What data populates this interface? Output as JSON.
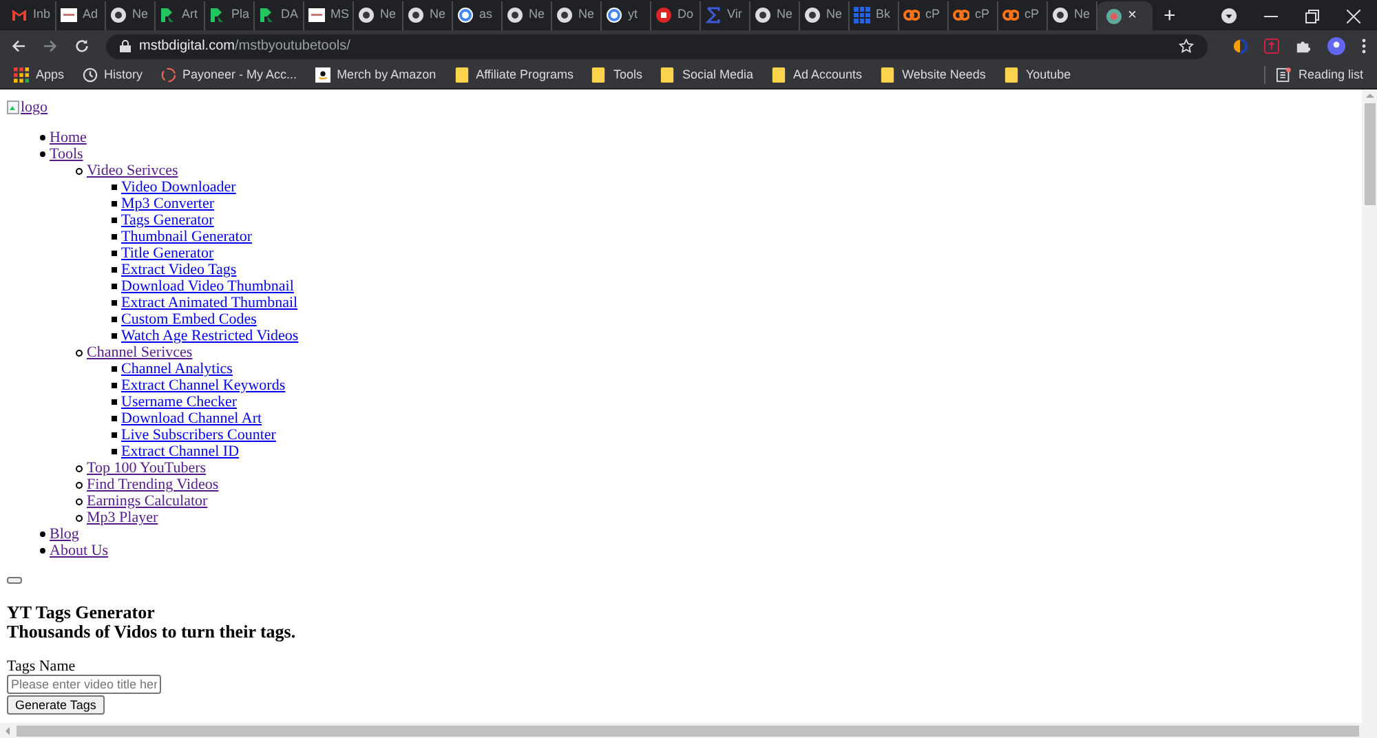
{
  "browser": {
    "tabs": [
      {
        "label": "Inb",
        "kind": "gmail",
        "selected": false
      },
      {
        "label": "Ad",
        "kind": "doc",
        "selected": false
      },
      {
        "label": "Ne",
        "kind": "chrome",
        "selected": false
      },
      {
        "label": "Art",
        "kind": "pr",
        "selected": false
      },
      {
        "label": "Pla",
        "kind": "pr",
        "selected": false
      },
      {
        "label": "DA",
        "kind": "pr",
        "selected": false
      },
      {
        "label": "MS",
        "kind": "doc",
        "selected": false
      },
      {
        "label": "Ne",
        "kind": "chrome",
        "selected": false
      },
      {
        "label": "Ne",
        "kind": "chrome",
        "selected": false
      },
      {
        "label": "as",
        "kind": "google",
        "selected": false
      },
      {
        "label": "Ne",
        "kind": "chrome",
        "selected": false
      },
      {
        "label": "Ne",
        "kind": "chrome",
        "selected": false
      },
      {
        "label": "yt",
        "kind": "google",
        "selected": false
      },
      {
        "label": "Do",
        "kind": "red",
        "selected": false
      },
      {
        "label": "Vir",
        "kind": "sigma",
        "selected": false
      },
      {
        "label": "Ne",
        "kind": "chrome",
        "selected": false
      },
      {
        "label": "Ne",
        "kind": "chrome",
        "selected": false
      },
      {
        "label": "Bk",
        "kind": "grid",
        "selected": false
      },
      {
        "label": "cP",
        "kind": "cpanel",
        "selected": false
      },
      {
        "label": "cP",
        "kind": "cpanel",
        "selected": false
      },
      {
        "label": "cP",
        "kind": "cpanel",
        "selected": false
      },
      {
        "label": "Ne",
        "kind": "chrome",
        "selected": false
      },
      {
        "kind": "site",
        "selected": true
      }
    ],
    "close": "×",
    "new_tab": "+",
    "address": {
      "domain": "mstbdigital.com",
      "path": "/mstbyoutubetools/"
    },
    "bookmarks": [
      {
        "label": "Apps",
        "kind": "apps"
      },
      {
        "label": "History",
        "kind": "history"
      },
      {
        "label": "Payoneer - My Acc...",
        "kind": "ring"
      },
      {
        "label": "Merch by Amazon",
        "kind": "amazon"
      },
      {
        "label": "Affiliate Programs",
        "kind": "folder"
      },
      {
        "label": "Tools",
        "kind": "folder"
      },
      {
        "label": "Social Media",
        "kind": "folder"
      },
      {
        "label": "Ad Accounts",
        "kind": "folder"
      },
      {
        "label": "Website Needs",
        "kind": "folder"
      },
      {
        "label": "Youtube",
        "kind": "folder"
      }
    ],
    "reading_list": "Reading list"
  },
  "page": {
    "logo_alt": "logo",
    "nav": [
      {
        "label": "Home",
        "visited": true
      },
      {
        "label": "Tools",
        "visited": true,
        "children": [
          {
            "label": "Video Serivces",
            "visited": true,
            "children": [
              {
                "label": "Video Downloader",
                "visited": false
              },
              {
                "label": "Mp3 Converter",
                "visited": false
              },
              {
                "label": "Tags Generator",
                "visited": false
              },
              {
                "label": "Thumbnail Generator",
                "visited": false
              },
              {
                "label": "Title Generator",
                "visited": false
              },
              {
                "label": "Extract Video Tags",
                "visited": false
              },
              {
                "label": "Download Video Thumbnail",
                "visited": false
              },
              {
                "label": "Extract Animated Thumbnail",
                "visited": false
              },
              {
                "label": "Custom Embed Codes",
                "visited": false
              },
              {
                "label": "Watch Age Restricted Videos",
                "visited": false
              }
            ]
          },
          {
            "label": "Channel Serivces",
            "visited": true,
            "children": [
              {
                "label": "Channel Analytics",
                "visited": false
              },
              {
                "label": "Extract Channel Keywords",
                "visited": false
              },
              {
                "label": "Username Checker",
                "visited": false
              },
              {
                "label": "Download Channel Art",
                "visited": false
              },
              {
                "label": "Live Subscribers Counter",
                "visited": false
              },
              {
                "label": "Extract Channel ID",
                "visited": false
              }
            ]
          },
          {
            "label": "Top 100 YouTubers",
            "visited": true
          },
          {
            "label": "Find Trending Videos",
            "visited": true
          },
          {
            "label": "Earnings Calculator",
            "visited": true
          },
          {
            "label": "Mp3 Player",
            "visited": true
          }
        ]
      },
      {
        "label": "Blog",
        "visited": true
      },
      {
        "label": "About Us",
        "visited": true
      }
    ],
    "heading": "YT Tags Generator",
    "subheading": "Thousands of Vidos to turn their tags.",
    "field_label": "Tags Name",
    "placeholder": "Please enter video title her",
    "button": "Generate Tags"
  }
}
